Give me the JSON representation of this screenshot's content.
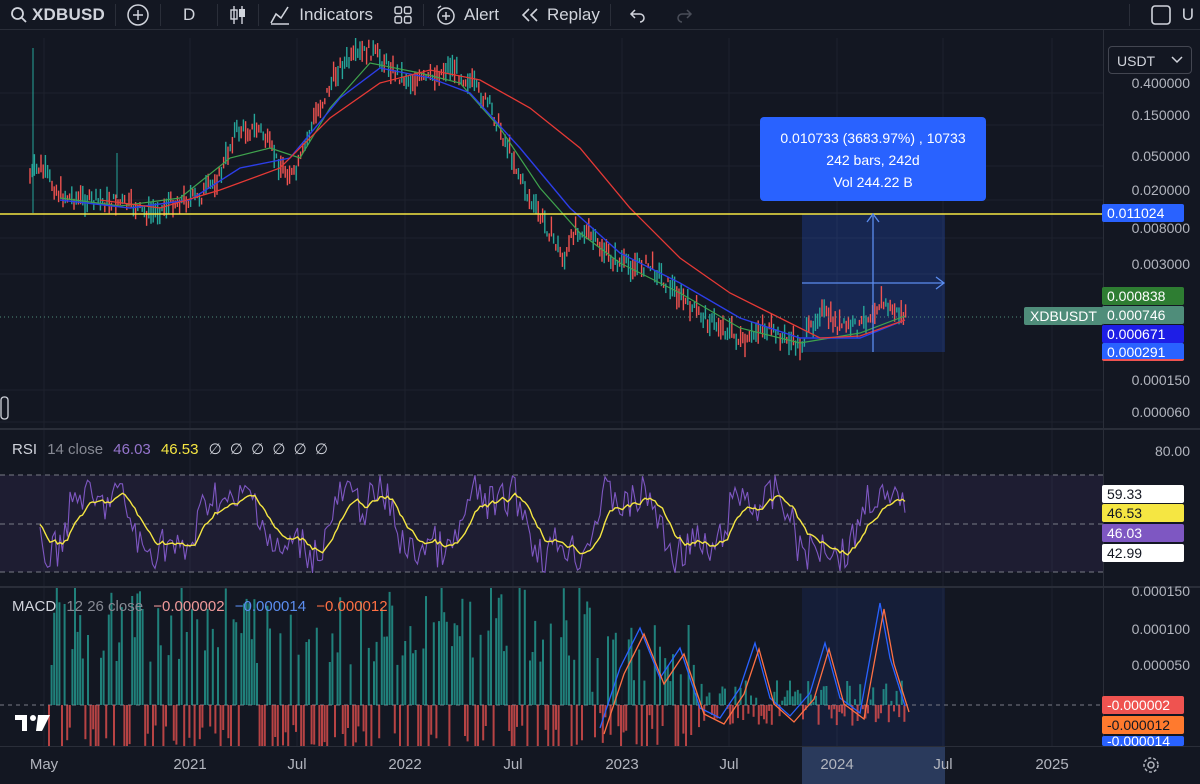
{
  "toolbar": {
    "symbol": "XDBUSD",
    "interval": "D",
    "indicators_label": "Indicators",
    "alert_label": "Alert",
    "replay_label": "Replay",
    "right_partial": "U"
  },
  "currency": {
    "selected": "USDT"
  },
  "price_axis": {
    "main_labels": [
      "0.400000",
      "0.150000",
      "0.050000",
      "0.020000",
      "0.008000",
      "0.003000",
      "0.000150",
      "0.000060"
    ],
    "rsi_labels": [
      "80.00"
    ],
    "macd_labels": [
      "0.000150",
      "0.000100",
      "0.000050"
    ]
  },
  "tags": {
    "hline": "0.011024",
    "measure_top": "0.000838",
    "last_price": "0.000746",
    "ma_a": "0.000671",
    "ma_b": "0.000291",
    "symbol": "XDBUSDT",
    "rsi_upper": "59.33",
    "rsi_ma": "46.53",
    "rsi_val": "46.03",
    "rsi_lower": "42.99",
    "macd_hist": "-0.000002",
    "macd_signal": "-0.000012",
    "macd_line": "-0.000014"
  },
  "measure": {
    "line1": "0.010733 (3683.97%) , 10733",
    "line2": "242 bars, 242d",
    "line3": "Vol 244.22 B"
  },
  "rsi_legend": {
    "name": "RSI",
    "params": "14 close",
    "value": "46.03",
    "ma_value": "46.53",
    "empties": [
      "∅",
      "∅",
      "∅",
      "∅",
      "∅",
      "∅"
    ]
  },
  "macd_legend": {
    "name": "MACD",
    "params": "12 26 close",
    "hist": "−0.000002",
    "macd": "−0.000014",
    "signal": "−0.000012"
  },
  "time_axis": [
    "May",
    "2021",
    "Jul",
    "2022",
    "Jul",
    "2023",
    "Jul",
    "2024",
    "Jul",
    "2025"
  ],
  "colors": {
    "background": "#131722",
    "up": "#26a69a",
    "down": "#ef5350",
    "accent": "#2962ff",
    "hline": "#f5e642",
    "rsi": "#7e57c2",
    "rsi_ma": "#f5e642"
  }
}
